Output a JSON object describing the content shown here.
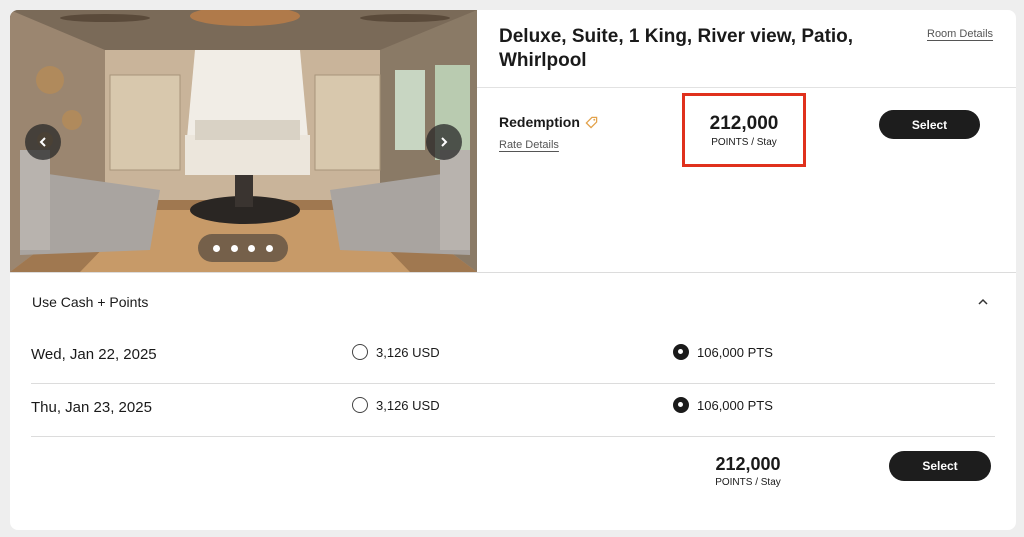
{
  "room": {
    "title_line1": "Deluxe, Suite, 1 King, River view, Patio,",
    "title_line2": "Whirlpool",
    "details_link": "Room Details"
  },
  "gallery": {
    "prev_icon": "chevron-left-icon",
    "next_icon": "chevron-right-icon",
    "dot_count": 4
  },
  "rate": {
    "label": "Redemption",
    "tag_icon": "tag-icon",
    "details_link": "Rate Details",
    "points": "212,000",
    "points_unit": "POINTS / Stay",
    "select_label": "Select",
    "highlight_color": "#e0311d"
  },
  "cash_points": {
    "label": "Use Cash + Points",
    "toggle_icon": "chevron-up-icon",
    "rows": [
      {
        "date": "Wed, Jan 22, 2025",
        "cash": "3,126 USD",
        "points": "106,000 PTS",
        "selected": "points"
      },
      {
        "date": "Thu, Jan 23, 2025",
        "cash": "3,126 USD",
        "points": "106,000 PTS",
        "selected": "points"
      }
    ],
    "total_points": "212,000",
    "total_unit": "POINTS / Stay",
    "select_label": "Select"
  }
}
